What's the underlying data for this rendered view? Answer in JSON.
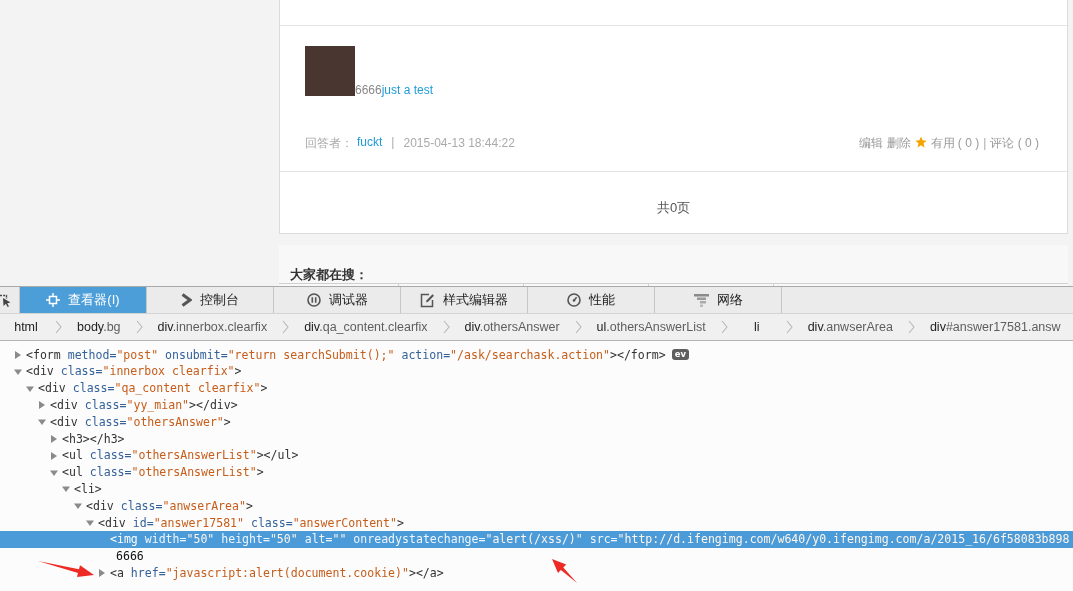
{
  "page": {
    "answer": {
      "text": "6666",
      "link": "just a test",
      "meta": {
        "label": "回答者：",
        "author": "fuckt",
        "separator": "|",
        "time": "2015-04-13 18:44:22"
      },
      "actions": {
        "edit": "编辑",
        "delete": "删除",
        "useful": "有用 ( 0 )",
        "separator": "|",
        "comment": "评论 ( 0 )"
      }
    },
    "pagination": "共0页",
    "hot_search": {
      "title": "大家都在搜："
    }
  },
  "devtools": {
    "tabs": [
      {
        "kind": "inspector",
        "label": "查看器(I)",
        "selected": true
      },
      {
        "kind": "console",
        "label": "控制台",
        "selected": false
      },
      {
        "kind": "debugger",
        "label": "调试器",
        "selected": false
      },
      {
        "kind": "style_editor",
        "label": "样式编辑器",
        "selected": false
      },
      {
        "kind": "performance",
        "label": "性能",
        "selected": false
      },
      {
        "kind": "network",
        "label": "网络",
        "selected": false
      }
    ],
    "breadcrumbs": [
      {
        "tag": "html"
      },
      {
        "tag": "body",
        "suffix": ".bg"
      },
      {
        "tag": "div",
        "suffix": ".innerbox.clearfix"
      },
      {
        "tag": "div",
        "suffix": ".qa_content.clearfix"
      },
      {
        "tag": "div",
        "suffix": ".othersAnswer"
      },
      {
        "tag": "ul",
        "suffix": ".othersAnswerList"
      },
      {
        "tag": "li"
      },
      {
        "tag": "div",
        "suffix": ".anwserArea"
      },
      {
        "tag": "div",
        "suffix": "#answer17581.answ"
      }
    ],
    "tree": [
      {
        "kind": "element",
        "expanded": false,
        "selected": false,
        "badge": "ev",
        "tokens": [
          {
            "kind": "tag",
            "text": "<form"
          },
          {
            "kind": "attr",
            "text": " method="
          },
          {
            "kind": "value",
            "text": "\"post\""
          },
          {
            "kind": "attr",
            "text": " onsubmit="
          },
          {
            "kind": "value",
            "text": "\"return searchSubmit();\""
          },
          {
            "kind": "attr",
            "text": " action="
          },
          {
            "kind": "value",
            "text": "\"/ask/searchask.action\""
          },
          {
            "kind": "tag",
            "text": "></form>"
          }
        ]
      },
      {
        "kind": "element",
        "expanded": true,
        "selected": false,
        "tokens": [
          {
            "kind": "tag",
            "text": "<div"
          },
          {
            "kind": "attr",
            "text": " class="
          },
          {
            "kind": "value",
            "text": "\"innerbox clearfix\""
          },
          {
            "kind": "tag",
            "text": ">"
          }
        ],
        "children": [
          {
            "kind": "element",
            "expanded": true,
            "selected": false,
            "tokens": [
              {
                "kind": "tag",
                "text": "<div"
              },
              {
                "kind": "attr",
                "text": " class="
              },
              {
                "kind": "value",
                "text": "\"qa_content clearfix\""
              },
              {
                "kind": "tag",
                "text": ">"
              }
            ],
            "children": [
              {
                "kind": "element",
                "expanded": false,
                "selected": false,
                "tokens": [
                  {
                    "kind": "tag",
                    "text": "<div"
                  },
                  {
                    "kind": "attr",
                    "text": " class="
                  },
                  {
                    "kind": "value",
                    "text": "\"yy_mian\""
                  },
                  {
                    "kind": "tag",
                    "text": "></div>"
                  }
                ]
              },
              {
                "kind": "element",
                "expanded": true,
                "selected": false,
                "tokens": [
                  {
                    "kind": "tag",
                    "text": "<div"
                  },
                  {
                    "kind": "attr",
                    "text": " class="
                  },
                  {
                    "kind": "value",
                    "text": "\"othersAnswer\""
                  },
                  {
                    "kind": "tag",
                    "text": ">"
                  }
                ],
                "children": [
                  {
                    "kind": "element",
                    "expanded": false,
                    "selected": false,
                    "tokens": [
                      {
                        "kind": "tag",
                        "text": "<h3></h3>"
                      }
                    ]
                  },
                  {
                    "kind": "element",
                    "expanded": false,
                    "selected": false,
                    "tokens": [
                      {
                        "kind": "tag",
                        "text": "<ul"
                      },
                      {
                        "kind": "attr",
                        "text": " class="
                      },
                      {
                        "kind": "value",
                        "text": "\"othersAnswerList\""
                      },
                      {
                        "kind": "tag",
                        "text": "></ul>"
                      }
                    ]
                  },
                  {
                    "kind": "element",
                    "expanded": true,
                    "selected": false,
                    "tokens": [
                      {
                        "kind": "tag",
                        "text": "<ul"
                      },
                      {
                        "kind": "attr",
                        "text": " class="
                      },
                      {
                        "kind": "value",
                        "text": "\"othersAnswerList\""
                      },
                      {
                        "kind": "tag",
                        "text": ">"
                      }
                    ],
                    "children": [
                      {
                        "kind": "element",
                        "expanded": true,
                        "selected": false,
                        "tokens": [
                          {
                            "kind": "tag",
                            "text": "<li>"
                          }
                        ],
                        "children": [
                          {
                            "kind": "element",
                            "expanded": true,
                            "selected": false,
                            "tokens": [
                              {
                                "kind": "tag",
                                "text": "<div"
                              },
                              {
                                "kind": "attr",
                                "text": " class="
                              },
                              {
                                "kind": "value",
                                "text": "\"anwserArea\""
                              },
                              {
                                "kind": "tag",
                                "text": ">"
                              }
                            ],
                            "children": [
                              {
                                "kind": "element",
                                "expanded": true,
                                "selected": false,
                                "tokens": [
                                  {
                                    "kind": "tag",
                                    "text": "<div"
                                  },
                                  {
                                    "kind": "attr",
                                    "text": " id="
                                  },
                                  {
                                    "kind": "value",
                                    "text": "\"answer17581\""
                                  },
                                  {
                                    "kind": "attr",
                                    "text": " class="
                                  },
                                  {
                                    "kind": "value",
                                    "text": "\"answerContent\""
                                  },
                                  {
                                    "kind": "tag",
                                    "text": ">"
                                  }
                                ],
                                "children": [
                                  {
                                    "kind": "leaf",
                                    "selected": true,
                                    "tokens": [
                                      {
                                        "kind": "tag",
                                        "text": "<img"
                                      },
                                      {
                                        "kind": "attr",
                                        "text": " width="
                                      },
                                      {
                                        "kind": "value",
                                        "text": "\"50\""
                                      },
                                      {
                                        "kind": "attr",
                                        "text": " height="
                                      },
                                      {
                                        "kind": "value",
                                        "text": "\"50\""
                                      },
                                      {
                                        "kind": "attr",
                                        "text": " alt="
                                      },
                                      {
                                        "kind": "value",
                                        "text": "\"\""
                                      },
                                      {
                                        "kind": "attr",
                                        "text": " onreadystatechange="
                                      },
                                      {
                                        "kind": "value",
                                        "text": "\"alert(/xss/)\""
                                      },
                                      {
                                        "kind": "attr",
                                        "text": " src="
                                      },
                                      {
                                        "kind": "value",
                                        "text": "\"http://d.ifengimg.com/w640/y0.ifengimg.com/a/2015_16/6f58083b898"
                                      }
                                    ]
                                  },
                                  {
                                    "kind": "text",
                                    "selected": false,
                                    "tokens": [
                                      {
                                        "kind": "text",
                                        "text": "6666"
                                      }
                                    ]
                                  },
                                  {
                                    "kind": "element",
                                    "expanded": false,
                                    "selected": false,
                                    "tokens": [
                                      {
                                        "kind": "tag",
                                        "text": "<a"
                                      },
                                      {
                                        "kind": "attr",
                                        "text": " href="
                                      },
                                      {
                                        "kind": "value",
                                        "text": "\"javascript:alert(document.cookie)\""
                                      },
                                      {
                                        "kind": "tag",
                                        "text": "></a>"
                                      }
                                    ]
                                  }
                                ]
                              }
                            ]
                          }
                        ]
                      }
                    ]
                  }
                ]
              }
            ]
          }
        ]
      }
    ]
  }
}
